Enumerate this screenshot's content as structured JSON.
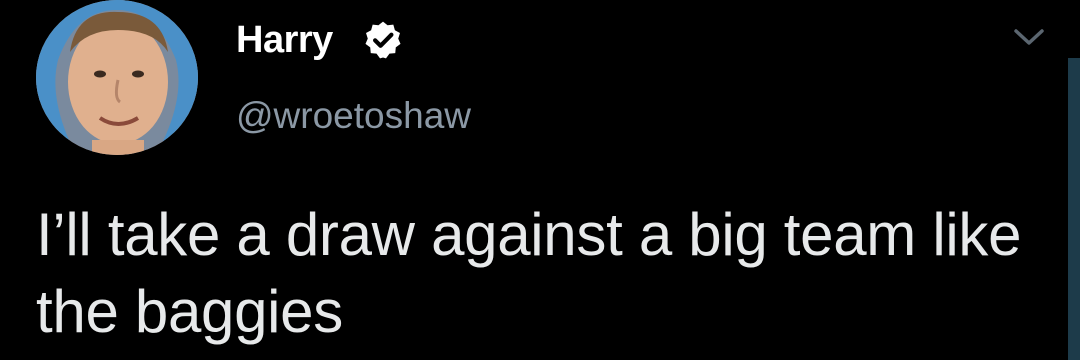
{
  "tweet": {
    "author": {
      "display_name": "Harry",
      "handle": "@wroetoshaw",
      "verified": true,
      "avatar_icon": "profile-photo"
    },
    "text": "I’ll take a draw against a big team like the baggies",
    "menu_icon": "chevron-down-icon"
  },
  "colors": {
    "background": "#000000",
    "name": "#ffffff",
    "handle": "#8b98a5",
    "text": "#e7e9ea",
    "verified_badge": "#ffffff"
  }
}
